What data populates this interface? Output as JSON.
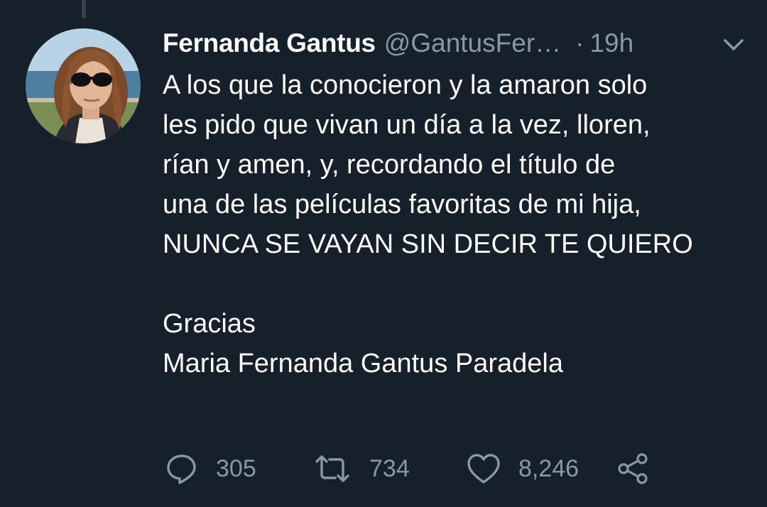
{
  "tweet": {
    "display_name": "Fernanda Gantus",
    "handle": "@GantusFer…",
    "separator": "·",
    "time": "19h",
    "text_lines": [
      "A los que la conocieron y la amaron solo",
      "les pido que vivan un día a la vez, lloren,",
      "rían y amen, y, recordando el título de",
      "una de las películas favoritas de mi hija,",
      "NUNCA SE VAYAN SIN DECIR TE QUIERO"
    ],
    "closing_lines": [
      "Gracias",
      "Maria Fernanda Gantus Paradela"
    ]
  },
  "actions": {
    "reply_icon": "reply-icon",
    "reply_count": "305",
    "retweet_icon": "retweet-icon",
    "retweet_count": "734",
    "like_icon": "heart-icon",
    "like_count": "8,246",
    "share_icon": "share-icon"
  },
  "colors": {
    "background": "#15202b",
    "primary_text": "#ffffff",
    "secondary_text": "#8899a6",
    "thread_line": "#38444d"
  }
}
